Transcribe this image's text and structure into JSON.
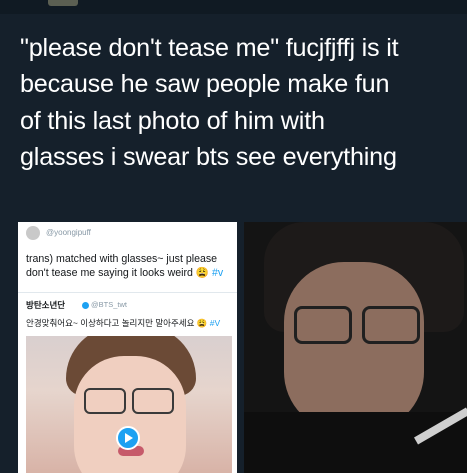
{
  "tweet": {
    "text": "\"please don't tease me\" fucjfjffj is it\nbecause he saw people make fun\nof this last photo of him with\nglasses i swear bts see everything"
  },
  "quoted_tweet": {
    "handle": "@yoongipuff",
    "text": "trans) matched with glasses~ just please don't tease me saying it looks weird",
    "hashtag": "#v"
  },
  "bts_tweet": {
    "name": "방탄소년단",
    "handle": "@BTS_twt",
    "text": "안경맞춰어요~ 이상하다고 놀리지만 말아주세요",
    "hashtag": "#V"
  },
  "icons": {
    "play": "play-icon",
    "verified": "verified-badge-icon"
  },
  "colors": {
    "background": "#15202b",
    "accent": "#1da1f2",
    "text": "#ffffff"
  }
}
